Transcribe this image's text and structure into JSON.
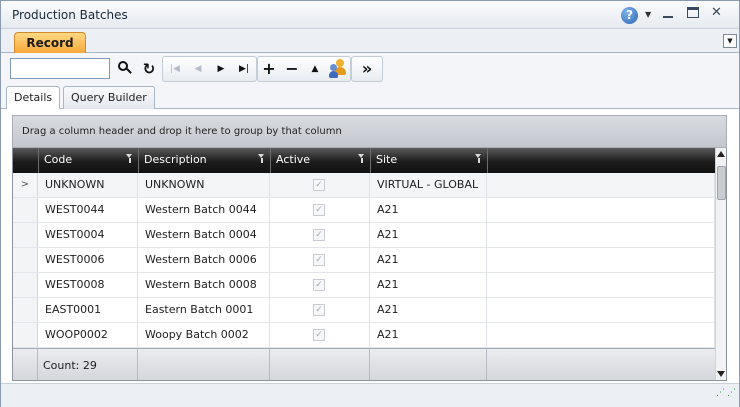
{
  "window": {
    "title": "Production Batches"
  },
  "tabs": {
    "record": "Record"
  },
  "toolbar": {
    "search_value": "",
    "first": "|◀",
    "prev": "◀",
    "next": "▶",
    "last": "▶|",
    "add": "+",
    "remove": "−",
    "up": "▲",
    "more": "»"
  },
  "subtabs": [
    "Details",
    "Query Builder"
  ],
  "grid": {
    "groupby_hint": "Drag a column header and drop it here to group by that column",
    "columns": [
      "Code",
      "Description",
      "Active",
      "Site"
    ],
    "rows": [
      {
        "code": "UNKNOWN",
        "description": "UNKNOWN",
        "active": true,
        "site": "VIRTUAL - GLOBAL"
      },
      {
        "code": "WEST0044",
        "description": "Western Batch 0044",
        "active": true,
        "site": "A21"
      },
      {
        "code": "WEST0004",
        "description": "Western Batch 0004",
        "active": true,
        "site": "A21"
      },
      {
        "code": "WEST0006",
        "description": "Western Batch 0006",
        "active": true,
        "site": "A21"
      },
      {
        "code": "WEST0008",
        "description": "Western Batch 0008",
        "active": true,
        "site": "A21"
      },
      {
        "code": "EAST0001",
        "description": "Eastern Batch 0001",
        "active": true,
        "site": "A21"
      },
      {
        "code": "WOOP0002",
        "description": "Woopy Batch 0002",
        "active": true,
        "site": "A21"
      }
    ],
    "selected_indicator": ">",
    "footer": "Count: 29"
  },
  "colors": {
    "tab_accent": "#f7a93b",
    "header_dark": "#1c1c1c",
    "frame": "#8a9bb0"
  },
  "icons": [
    "help-icon",
    "search-icon",
    "refresh-icon",
    "users-icon",
    "filter-icon",
    "resize-grip-icon"
  ]
}
